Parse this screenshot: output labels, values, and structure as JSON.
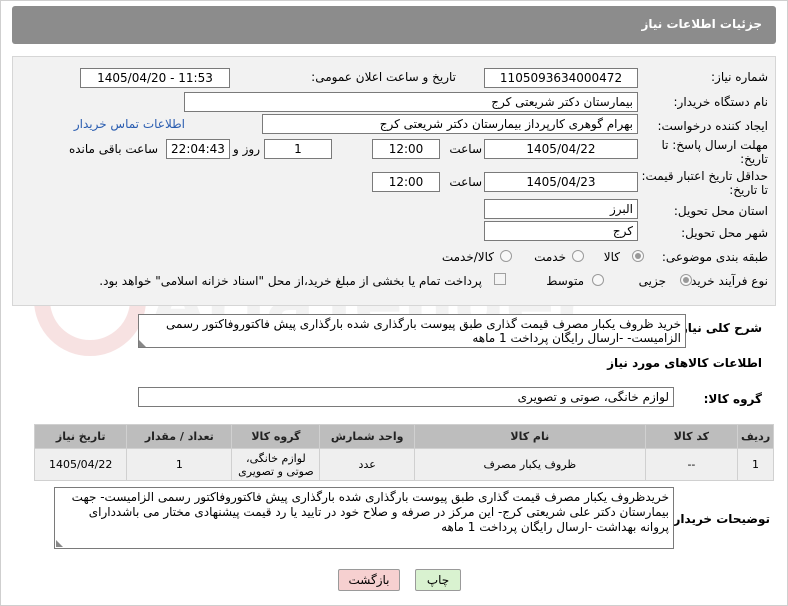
{
  "header": {
    "title": "جزئیات اطلاعات نیاز"
  },
  "form": {
    "need_number_label": "شماره نیاز:",
    "need_number": "1105093634000472",
    "announce_label": "تاریخ و ساعت اعلان عمومی:",
    "announce_value": "1405/04/20 - 11:53",
    "buyer_org_label": "نام دستگاه خریدار:",
    "buyer_org": "بیمارستان دکتر شریعتی کرج",
    "creator_label": "ایجاد کننده درخواست:",
    "creator": "بهرام گوهری کارپرداز بیمارستان دکتر شریعتی کرج",
    "contact_link": "اطلاعات تماس خریدار",
    "deadline_label_1": "مهلت ارسال پاسخ: تا",
    "deadline_label_2": "تاریخ:",
    "deadline_date": "1405/04/22",
    "time_label": "ساعت",
    "deadline_time": "12:00",
    "days_value": "1",
    "days_label": "روز و",
    "remaining_time": "22:04:43",
    "remaining_label": "ساعت باقی مانده",
    "validity_label_1": "حداقل تاریخ اعتبار قیمت:",
    "validity_label_2": "تا تاریخ:",
    "validity_date": "1405/04/23",
    "validity_time": "12:00",
    "province_label": "استان محل تحویل:",
    "province": "البرز",
    "city_label": "شهر محل تحویل:",
    "city": "کرج",
    "category_label": "طبقه بندی موضوعی:",
    "category_options": [
      "کالا",
      "خدمت",
      "کالا/خدمت"
    ],
    "category_selected": "کالا",
    "process_label": "نوع فرآیند خرید :",
    "process_options": [
      "جزیی",
      "متوسط"
    ],
    "process_selected": "جزیی",
    "payment_note": "پرداخت تمام یا بخشی از مبلغ خرید،از محل \"اسناد خزانه اسلامی\" خواهد بود."
  },
  "description": {
    "label": "شرح کلی نیاز:",
    "text": "خرید ظروف یکبار مصرف قیمت گذاری  طبق پیوست بارگذاری شده بارگذاری پیش فاکتوروفاکتور رسمی الزامیست- -ارسال رایگان پرداخت 1 ماهه"
  },
  "goods": {
    "section_title": "اطلاعات کالاهای مورد نیاز",
    "group_label": "گروه کالا:",
    "group_value": "لوازم خانگی، صوتی و تصویری",
    "columns": [
      "ردیف",
      "کد کالا",
      "نام کالا",
      "واحد شمارش",
      "گروه کالا",
      "تعداد / مقدار",
      "تاریخ نیاز"
    ],
    "rows": [
      {
        "row": "1",
        "code": "--",
        "name": "ظروف یکبار مصرف",
        "unit": "عدد",
        "group_line1": "لوازم خانگی،",
        "group_line2": "صوتی و تصویری",
        "qty": "1",
        "date": "1405/04/22"
      }
    ]
  },
  "buyer_notes": {
    "label": "توضیحات خریدار:",
    "text": "خریدظروف یکبار مصرف قیمت گذاری  طبق پیوست بارگذاری شده بارگذاری پیش فاکتوروفاکتور رسمی الزامیست- جهت بیمارستان دکتر علی شریعتی کرج- این مرکز در صرفه و صلاح خود در تایید یا رد قیمت پیشنهادی مختار می باشددارای پروانه بهداشت -ارسال رایگان پرداخت 1 ماهه"
  },
  "actions": {
    "print_label": "چاپ",
    "back_label": "بازگشت"
  },
  "watermark": {
    "text": "AriaTender.net"
  },
  "colors": {
    "header_bg": "#8c8c8c",
    "table_header_bg": "#bdbdbd",
    "link": "#2a5db0",
    "print_btn_bg": "#d9f2d0",
    "back_btn_bg": "#f6d0d0"
  }
}
